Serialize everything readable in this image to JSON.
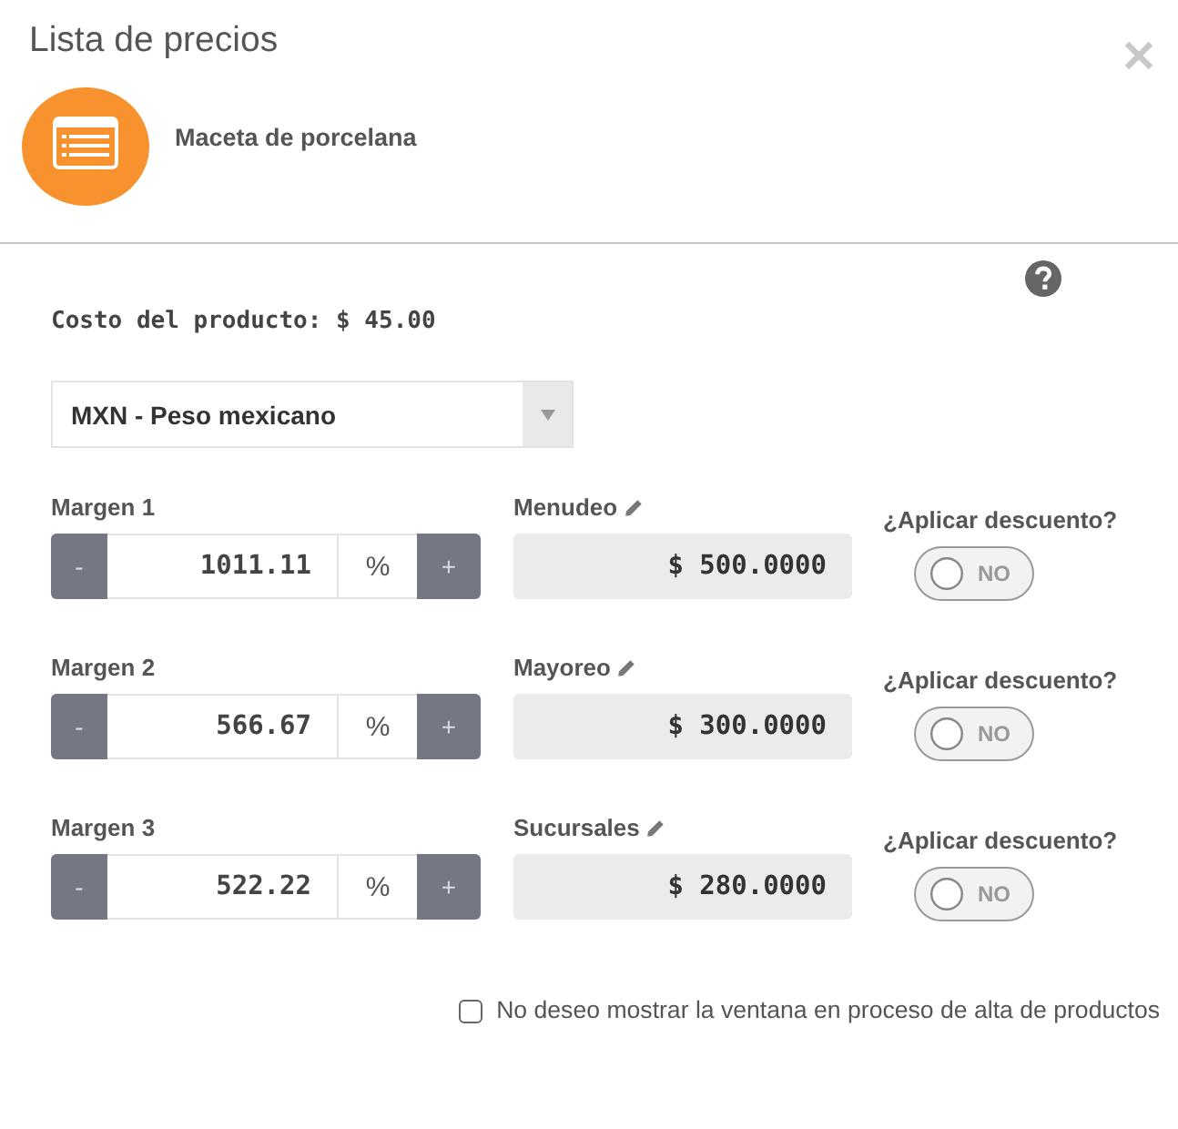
{
  "dialog": {
    "title": "Lista de precios"
  },
  "product": {
    "name": "Maceta de porcelana"
  },
  "cost": {
    "text": "Costo del producto: $ 45.00"
  },
  "currency_select": {
    "value": "MXN - Peso mexicano"
  },
  "margins": [
    {
      "label": "Margen 1",
      "minus": "-",
      "value": "1011.11",
      "unit": "%",
      "plus": "+",
      "price_label": "Menudeo",
      "price": "$ 500.0000",
      "discount_label": "¿Aplicar descuento?",
      "discount": {
        "on": false,
        "text": "NO"
      }
    },
    {
      "label": "Margen 2",
      "minus": "-",
      "value": "566.67",
      "unit": "%",
      "plus": "+",
      "price_label": "Mayoreo",
      "price": "$ 300.0000",
      "discount_label": "¿Aplicar descuento?",
      "discount": {
        "on": false,
        "text": "NO"
      }
    },
    {
      "label": "Margen 3",
      "minus": "-",
      "value": "522.22",
      "unit": "%",
      "plus": "+",
      "price_label": "Sucursales",
      "price": "$ 280.0000",
      "discount_label": "¿Aplicar descuento?",
      "discount": {
        "on": false,
        "text": "NO"
      }
    }
  ],
  "hide_option": {
    "label": "No deseo mostrar la ventana en proceso de alta de productos",
    "checked": false
  }
}
